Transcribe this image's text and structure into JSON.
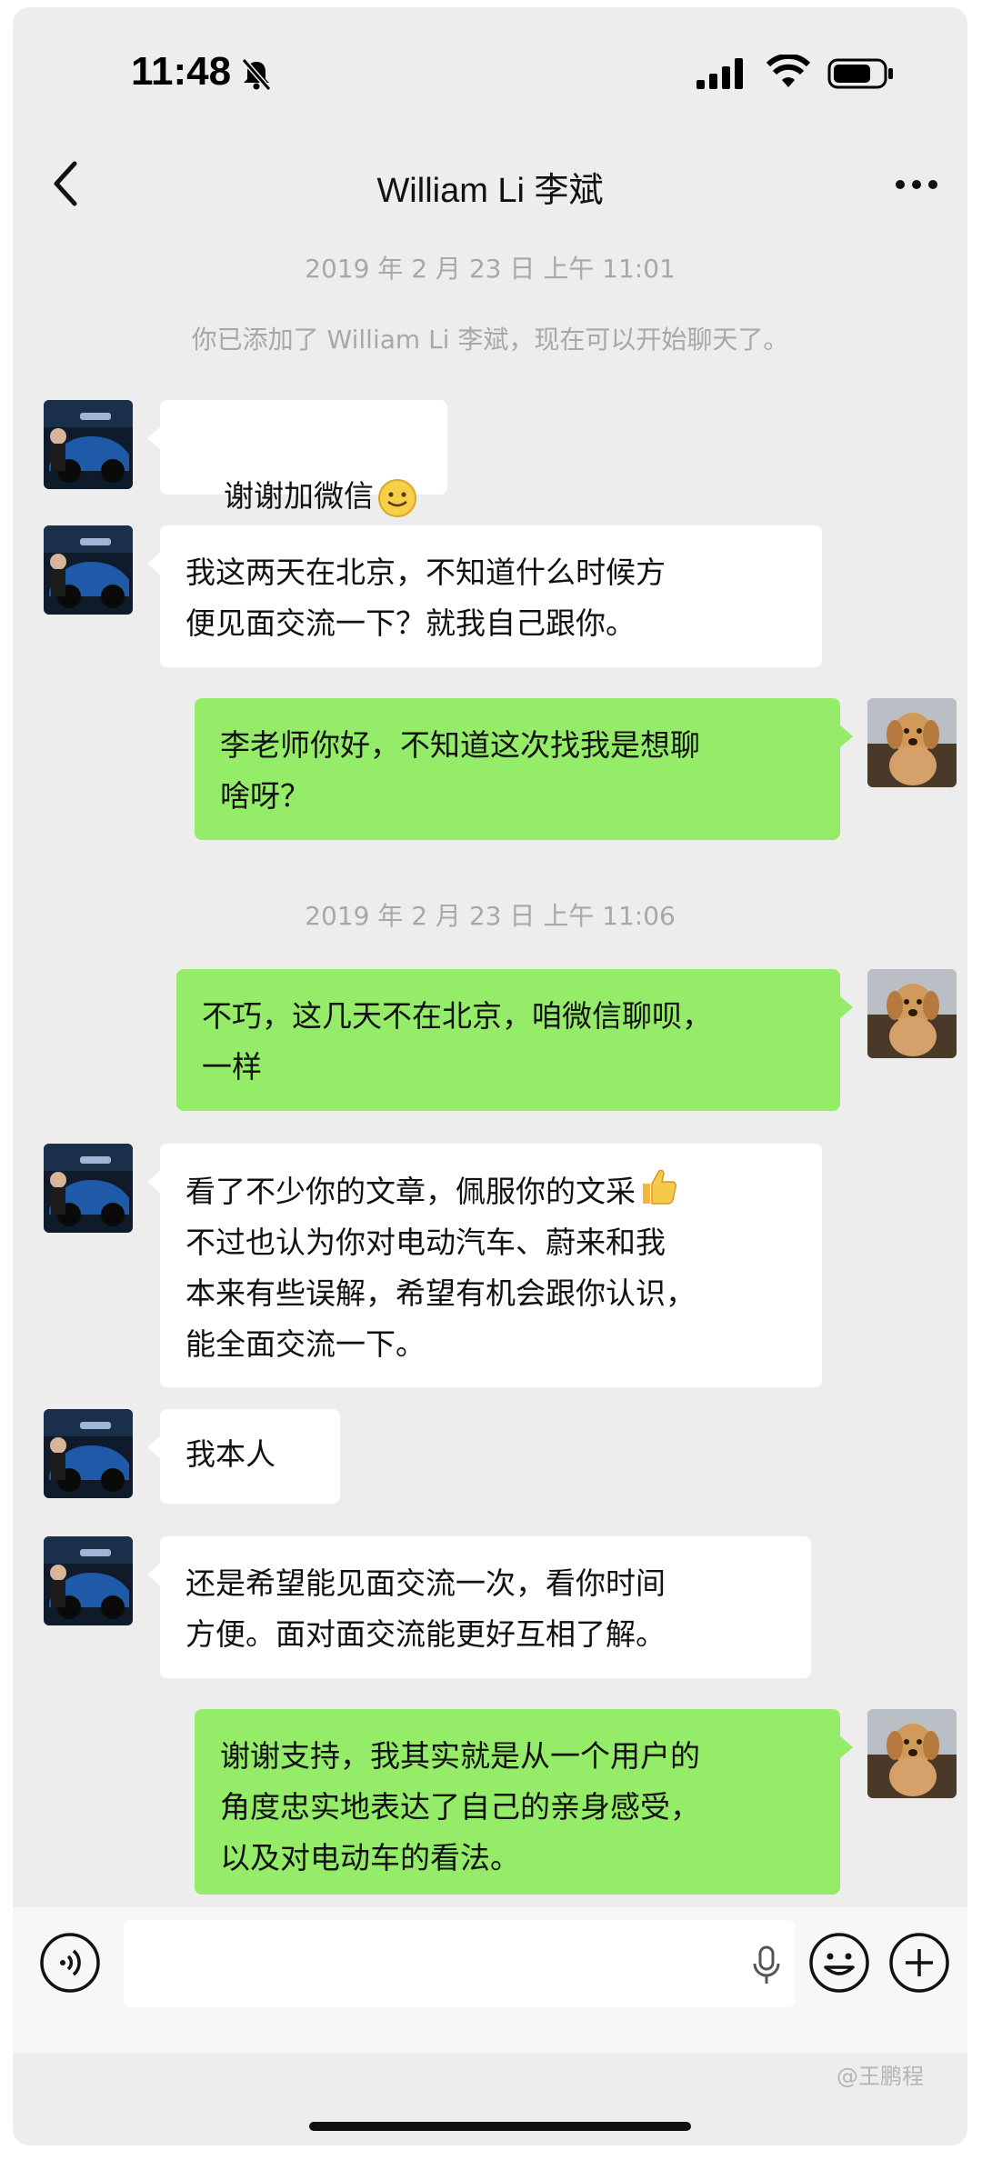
{
  "status_bar": {
    "time": "11:48"
  },
  "nav": {
    "title": "William Li 李斌"
  },
  "chat": {
    "timestamp_1": "2019 年 2 月 23 日 上午 11:01",
    "system_message": "你已添加了 William Li 李斌，现在可以开始聊天了。",
    "msg_1": "谢谢加微信",
    "msg_2": "我这两天在北京，不知道什么时候方\n便见面交流一下？就我自己跟你。",
    "msg_3": "李老师你好，不知道这次找我是想聊\n啥呀？",
    "timestamp_2": "2019 年 2 月 23 日 上午 11:06",
    "msg_4": "不巧，这几天不在北京，咱微信聊呗，\n一样",
    "msg_5_line1": "看了不少你的文章，佩服你的文采",
    "msg_5_rest": "不过也认为你对电动汽车、蔚来和我\n本来有些误解，希望有机会跟你认识，\n能全面交流一下。",
    "msg_6": "我本人",
    "msg_7": "还是希望能见面交流一次，看你时间\n方便。面对面交流能更好互相了解。",
    "msg_8": "谢谢支持，我其实就是从一个用户的\n角度忠实地表达了自己的亲身感受，\n以及对电动车的看法。"
  },
  "watermark": "@王鹏程",
  "colors": {
    "background": "#ededed",
    "incoming_bubble": "#ffffff",
    "outgoing_bubble": "#95ec69",
    "timestamp_text": "#a8a8a8"
  }
}
